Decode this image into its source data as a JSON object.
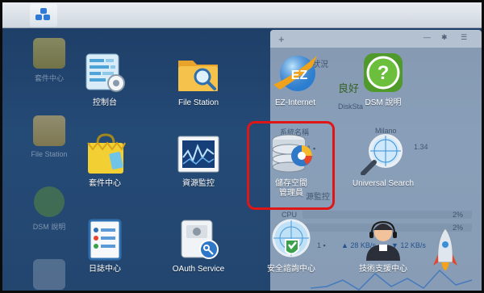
{
  "taskbar": {
    "main_menu_icon": "grid-icon"
  },
  "background_desktop": [
    {
      "label": "套件中心",
      "icon": "package-icon"
    },
    {
      "label": "File Station",
      "icon": "folder-icon"
    },
    {
      "label": "DSM 說明",
      "icon": "help-icon"
    }
  ],
  "widget": {
    "status_title": "統狀況",
    "status_value": "良好",
    "diskstation": "DiskSta",
    "system_name": "系統名稱",
    "server_name": "Milano",
    "row2": "路 1 ▪",
    "row3": "間",
    "monitor": "源監控",
    "cpu": "CPU",
    "pct1": "2%",
    "pct2": "2%",
    "network": "1 ▪",
    "net_up": "▲ 28 KB/s",
    "net_down": "▼ 12 KB/s",
    "value": "1.34"
  },
  "apps": [
    {
      "label": "控制台",
      "icon": "control-panel-icon"
    },
    {
      "label": "File Station",
      "icon": "folder-search-icon"
    },
    {
      "label": "EZ-Internet",
      "icon": "ez-internet-icon"
    },
    {
      "label": "DSM 說明",
      "icon": "help-icon"
    },
    {
      "label": "套件中心",
      "icon": "package-icon"
    },
    {
      "label": "資源監控",
      "icon": "resource-monitor-icon"
    },
    {
      "label": "儲存空間\n管理員",
      "icon": "storage-manager-icon"
    },
    {
      "label": "Universal Search",
      "icon": "universal-search-icon"
    },
    {
      "label": "日誌中心",
      "icon": "log-center-icon"
    },
    {
      "label": "OAuth Service",
      "icon": "oauth-service-icon"
    },
    {
      "label": "安全諮詢中心",
      "icon": "security-advisor-icon"
    },
    {
      "label": "技術支援中心",
      "icon": "support-center-icon"
    }
  ],
  "colors": {
    "accent": "#2f7ad4",
    "highlight": "#e01515",
    "desktop": "#244a76"
  }
}
